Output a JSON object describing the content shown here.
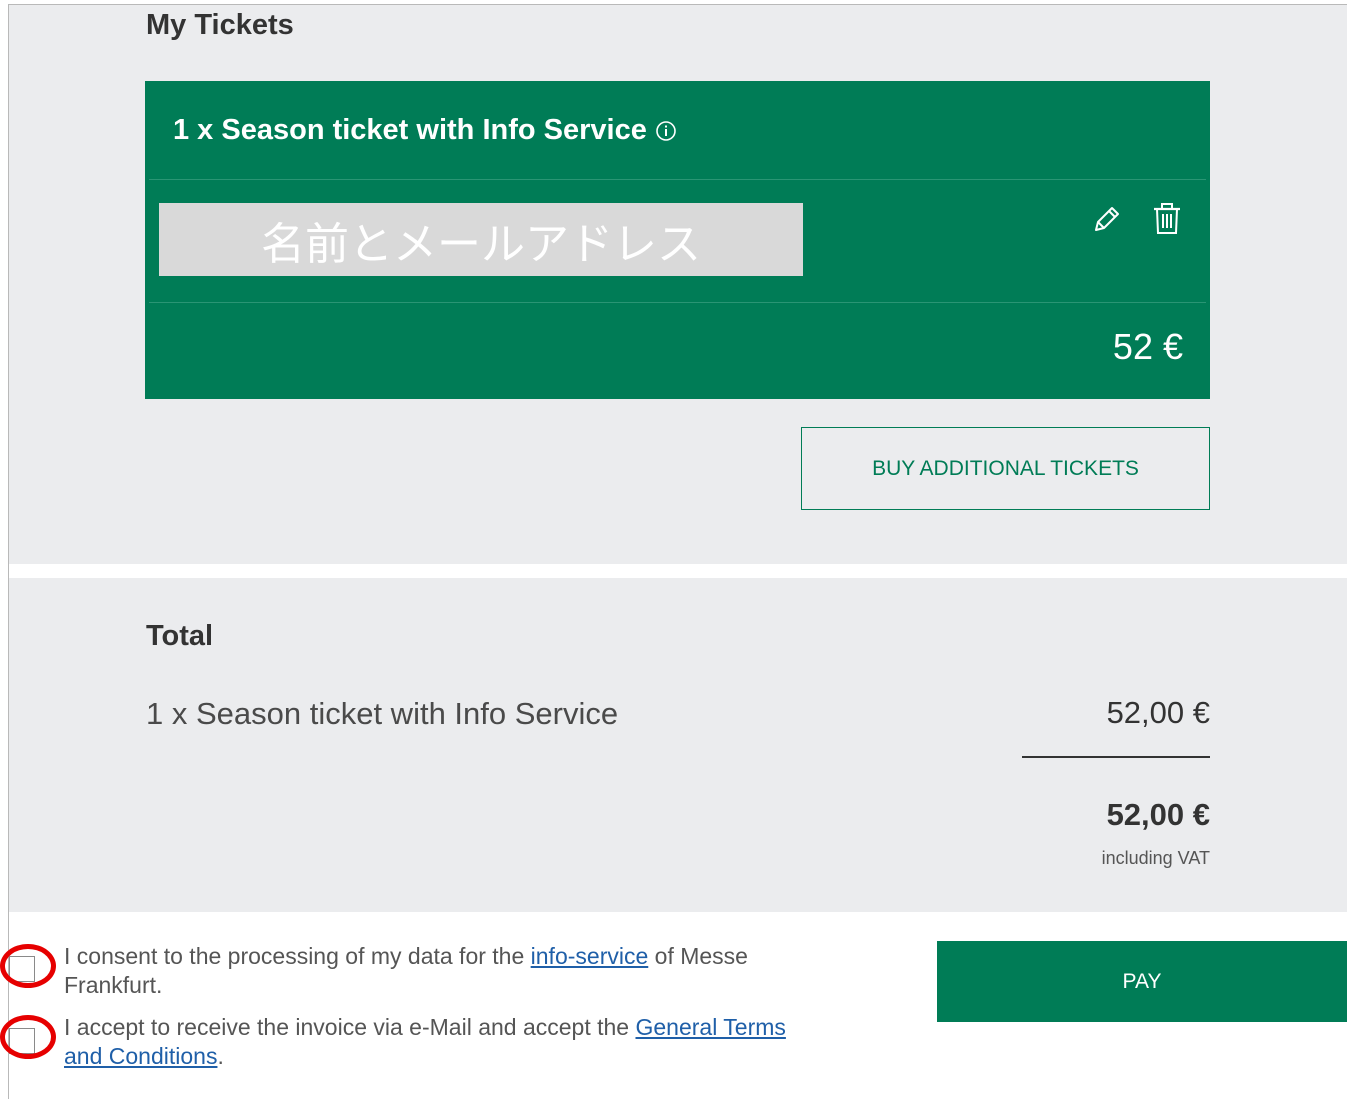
{
  "tickets": {
    "heading": "My Tickets",
    "card": {
      "title": "1 x Season ticket with Info Service",
      "info_icon": "info-circle-icon",
      "name_placeholder": "名前とメールアドレス",
      "edit_icon": "pencil-icon",
      "delete_icon": "trash-icon",
      "price": "52 €"
    },
    "buy_more_label": "BUY ADDITIONAL TICKETS"
  },
  "total": {
    "heading": "Total",
    "line_item_label": "1 x Season ticket with Info Service",
    "line_item_price": "52,00 €",
    "total_price": "52,00 €",
    "vat_note": "including VAT"
  },
  "consents": [
    {
      "text_before": "I consent to the processing of my data for the ",
      "link": "info-service",
      "text_after": " of Messe Frankfurt."
    },
    {
      "text_before": "I accept to receive the invoice via e-Mail and accept the ",
      "link": "General Terms and Conditions",
      "text_after": "."
    }
  ],
  "pay_label": "PAY",
  "colors": {
    "brand_green": "#007c56",
    "highlight_red": "#e60000",
    "section_gray": "#ebecee",
    "link_blue": "#1f5fa8"
  }
}
